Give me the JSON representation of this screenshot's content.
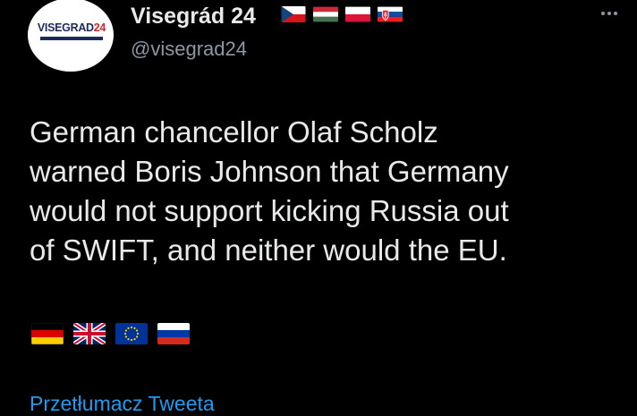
{
  "account": {
    "display_name": "Visegrád 24",
    "handle": "@visegrad24",
    "avatar_logo_text_main": "VISEGRAD",
    "avatar_logo_text_accent": "24",
    "header_flags": [
      "czech-flag-icon",
      "hungary-flag-icon",
      "poland-flag-icon",
      "slovakia-flag-icon"
    ]
  },
  "tweet": {
    "text_lines": [
      "German chancellor Olaf Scholz",
      "warned Boris Johnson that Germany",
      "would not support kicking Russia out",
      "of SWIFT, and neither would the EU."
    ],
    "body_flags": [
      "germany-flag-icon",
      "uk-flag-icon",
      "eu-flag-icon",
      "russia-flag-icon"
    ]
  },
  "actions": {
    "more_icon": "more-dots-icon",
    "translate_label": "Przetłumacz Tweeta"
  },
  "colors": {
    "background": "#000000",
    "text": "#e7e9ea",
    "secondary_text": "#8b98a5",
    "link": "#1d9bf0"
  }
}
